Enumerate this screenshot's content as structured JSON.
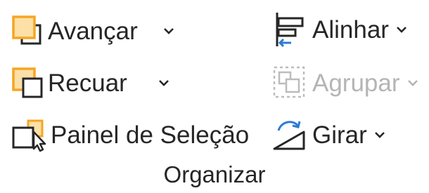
{
  "group": {
    "label": "Organizar"
  },
  "commands": {
    "avancar": {
      "label": "Avançar",
      "icon": "bring-forward-icon",
      "enabled": true
    },
    "recuar": {
      "label": "Recuar",
      "icon": "send-backward-icon",
      "enabled": true
    },
    "painel_selecao": {
      "label": "Painel de Seleção",
      "icon": "selection-pane-icon",
      "enabled": true
    },
    "alinhar": {
      "label": "Alinhar",
      "icon": "align-icon",
      "enabled": true
    },
    "agrupar": {
      "label": "Agrupar",
      "icon": "group-objects-icon",
      "enabled": false
    },
    "girar": {
      "label": "Girar",
      "icon": "rotate-icon",
      "enabled": true
    }
  },
  "colors": {
    "accent_orange": "#F5A623",
    "accent_fill": "#FCE0A8",
    "accent_blue": "#2B7CD3",
    "text": "#262626",
    "disabled_text": "#B5B5B5"
  }
}
